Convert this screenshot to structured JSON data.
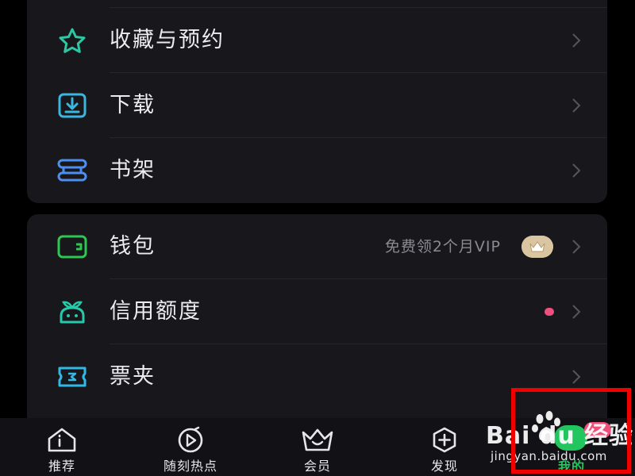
{
  "menu_top": [
    {
      "label": "收藏与预约",
      "icon": "star-icon"
    },
    {
      "label": "下载",
      "icon": "download-icon"
    },
    {
      "label": "书架",
      "icon": "bookshelf-icon"
    }
  ],
  "menu_bottom": [
    {
      "label": "钱包",
      "icon": "wallet-icon",
      "extra": "免费领2个月VIP"
    },
    {
      "label": "信用额度",
      "icon": "credit-icon"
    },
    {
      "label": "票夹",
      "icon": "ticket-icon"
    }
  ],
  "tabbar": [
    {
      "label": "推荐",
      "icon": "home-icon"
    },
    {
      "label": "随刻热点",
      "icon": "play-icon"
    },
    {
      "label": "会员",
      "icon": "crown-icon"
    },
    {
      "label": "发现",
      "icon": "add-icon"
    },
    {
      "label": "我的",
      "icon": "profile-icon"
    }
  ],
  "watermark": {
    "brand": "Bai du 经验",
    "url": "jingyan.baidu.com"
  },
  "colors": {
    "accent_green": "#21c65e",
    "star_icon": "#2ec7a4",
    "download_icon": "#3bb6e0",
    "bookshelf_icon": "#4d8ff0",
    "wallet_icon": "#2fc651",
    "credit_icon": "#27c9a8",
    "ticket_icon": "#33b8e6",
    "badge_pink": "#ee4e78",
    "highlight_red": "#f00100"
  }
}
